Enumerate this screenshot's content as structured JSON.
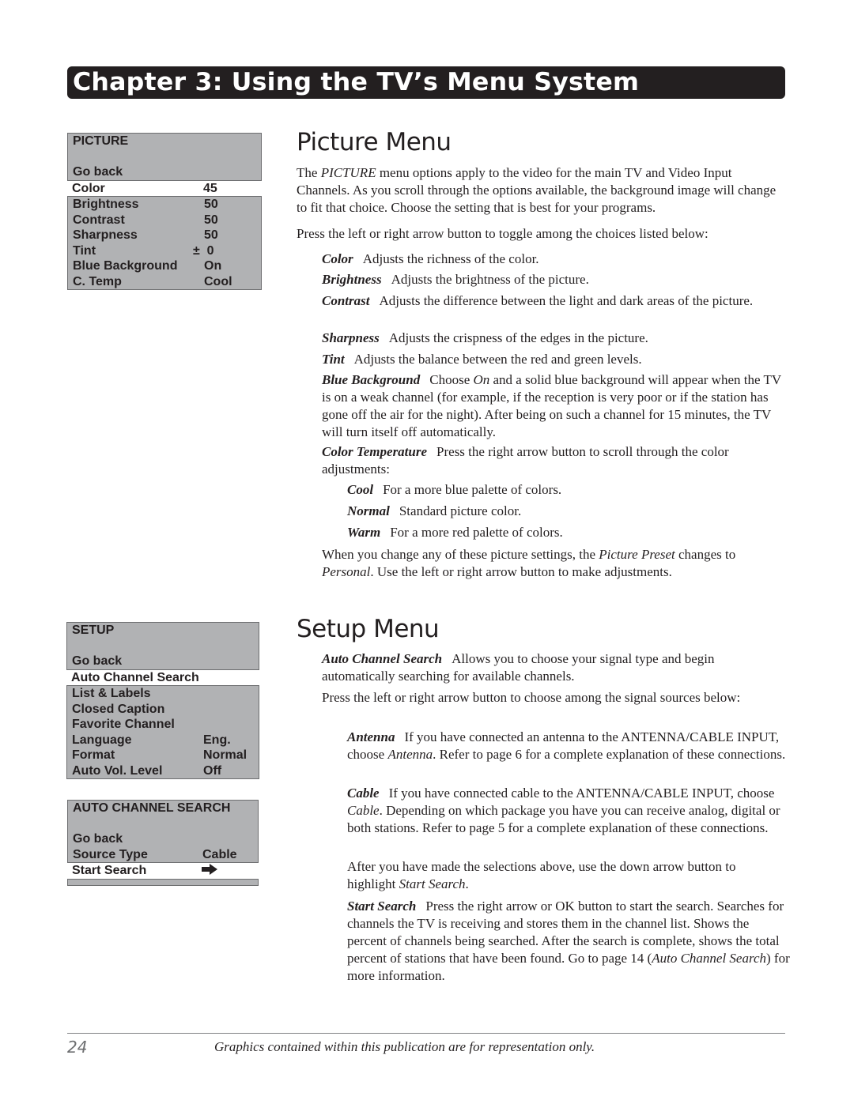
{
  "chapter": {
    "title": "Chapter 3: Using the TV’s Menu System"
  },
  "picture_menu": {
    "header": "PICTURE",
    "go_back": "Go back",
    "selected": {
      "label": "Color",
      "value": "45"
    },
    "items": [
      {
        "label": "Brightness",
        "value": "50"
      },
      {
        "label": "Contrast",
        "value": "50"
      },
      {
        "label": "Sharpness",
        "value": "50"
      },
      {
        "label": "Tint",
        "value": "±  0"
      },
      {
        "label": "Blue Background",
        "value": "On"
      },
      {
        "label": "C. Temp",
        "value": "Cool"
      }
    ]
  },
  "setup_menu": {
    "header": "SETUP",
    "go_back": "Go back",
    "selected": {
      "label": "Auto Channel Search",
      "value": ""
    },
    "items": [
      {
        "label": "List & Labels",
        "value": ""
      },
      {
        "label": "Closed Caption",
        "value": ""
      },
      {
        "label": "Favorite Channel",
        "value": ""
      },
      {
        "label": "Language",
        "value": "Eng."
      },
      {
        "label": "Format",
        "value": "Normal"
      },
      {
        "label": "Auto Vol. Level",
        "value": "Off"
      }
    ]
  },
  "acs_menu": {
    "header": "AUTO CHANNEL SEARCH",
    "go_back": "Go back",
    "source_type": {
      "label": "Source Type",
      "value": "Cable"
    },
    "selected": {
      "label": "Start Search",
      "icon": "right-arrow-icon"
    }
  },
  "picture_section": {
    "heading": "Picture Menu",
    "intro_pre": "The ",
    "intro_it": "PICTURE",
    "intro_post": " menu options apply to the video for the main TV and Video Input Channels. As you scroll through the options available, the background image will change to fit that choice. Choose the setting that is best for your programs.",
    "toggle_note": "Press the left or right arrow button to toggle among the choices listed below:",
    "options": [
      {
        "term": "Color",
        "desc": "Adjusts the richness of the color."
      },
      {
        "term": "Brightness",
        "desc": "Adjusts the brightness of the picture."
      },
      {
        "term": "Contrast",
        "desc": "Adjusts the difference between the light and dark areas of the picture."
      },
      {
        "term": "Sharpness",
        "desc": "Adjusts the crispness of the edges in the picture."
      },
      {
        "term": "Tint",
        "desc": "Adjusts the balance between the red and green levels."
      }
    ],
    "blue_bg": {
      "term": "Blue Background",
      "pre": "Choose ",
      "it": "On",
      "post": " and a solid blue background will appear when the TV is on a weak channel (for example, if the reception is very poor or if the station has gone off the air for the night). After being on such a channel for 15 minutes, the TV will turn itself off automatically."
    },
    "color_temp": {
      "term": "Color Temperature",
      "desc": "Press the right arrow button to scroll through the color adjustments:",
      "options": [
        {
          "term": "Cool",
          "desc": "For a more blue palette of colors."
        },
        {
          "term": "Normal",
          "desc": "Standard picture color."
        },
        {
          "term": "Warm",
          "desc": "For a more red palette of colors."
        }
      ]
    },
    "closing": {
      "pre": "When you change any of these picture settings, the ",
      "it1": "Picture Preset",
      "mid": " changes to ",
      "it2": "Personal",
      "post": ". Use the left or right arrow button to make adjustments."
    }
  },
  "setup_section": {
    "heading": "Setup Menu",
    "acs": {
      "term": "Auto Channel Search",
      "desc": "Allows you to choose your signal type and begin automatically searching for available channels."
    },
    "signal_note": "Press the left or right arrow button to choose among the signal sources below:",
    "antenna": {
      "term": "Antenna",
      "pre": "If you have connected an antenna to the ANTENNA/CABLE INPUT, choose ",
      "it": "Antenna",
      "post": ". Refer to page 6 for a complete explanation of these connections."
    },
    "cable": {
      "term": "Cable",
      "pre": "If you have connected cable to the ANTENNA/CABLE INPUT, choose ",
      "it": "Cable",
      "post": ". Depending on which package you have you can receive analog, digital or both stations. Refer to page 5 for a complete explanation of these connections."
    },
    "after": {
      "pre": "After you have made the selections above, use the down arrow button to highlight ",
      "it": "Start Search",
      "post": "."
    },
    "start_search": {
      "term": "Start Search",
      "pre": "Press the right arrow or OK button to start the search. Searches for channels the TV is receiving and stores them in the channel list. Shows the percent of channels being searched. After the search is complete, shows the total percent of stations that have been found. Go to page 14 (",
      "it": "Auto Channel Search",
      "post": ") for more information."
    }
  },
  "footer": {
    "page_number": "24",
    "note": "Graphics contained within this publication are for representation only."
  }
}
